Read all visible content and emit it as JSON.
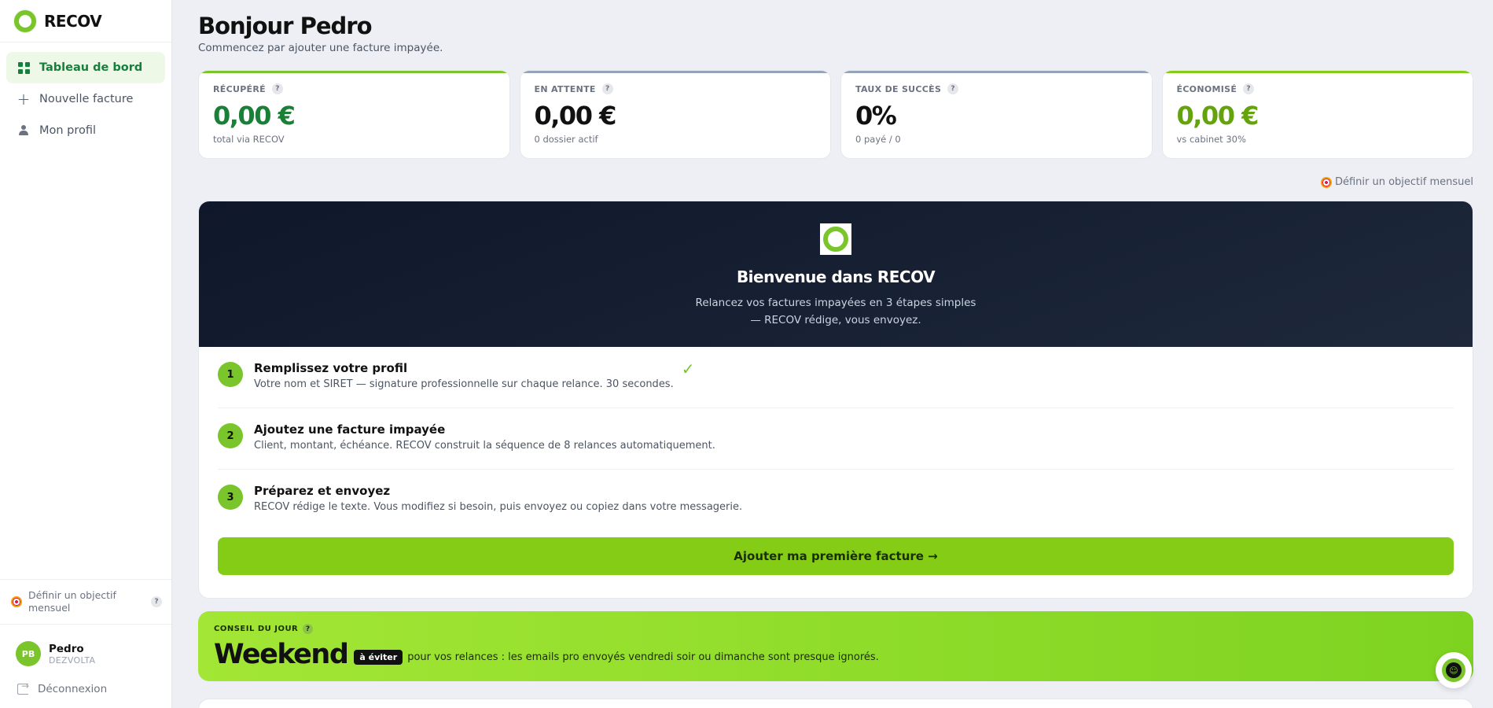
{
  "brand": {
    "name": "RECOV"
  },
  "sidebar": {
    "items": [
      {
        "label": "Tableau de bord",
        "icon": "dashboard-grid-icon",
        "active": true
      },
      {
        "label": "Nouvelle facture",
        "icon": "plus-icon",
        "active": false
      },
      {
        "label": "Mon profil",
        "icon": "user-icon",
        "active": false
      }
    ],
    "goal": {
      "label": "Définir un objectif mensuel",
      "help": "?"
    },
    "user": {
      "initials": "PB",
      "name": "Pedro",
      "company": "DEZVOLTA"
    },
    "logout": "Déconnexion"
  },
  "header": {
    "greeting": "Bonjour Pedro",
    "subtitle": "Commencez par ajouter une facture impayée."
  },
  "stats": [
    {
      "label": "RÉCUPÉRÉ",
      "help": "?",
      "value": "0,00 €",
      "sub": "total via RECOV",
      "color": "#1a7f37",
      "bar": "#7ac52b"
    },
    {
      "label": "EN ATTENTE",
      "help": "?",
      "value": "0,00 €",
      "sub": "0 dossier actif",
      "color": "#111111",
      "bar": "#94a3b8"
    },
    {
      "label": "TAUX DE SUCCÈS",
      "help": "?",
      "value": "0%",
      "sub": "0 payé / 0",
      "color": "#111111",
      "bar": "#94a3b8"
    },
    {
      "label": "ÉCONOMISÉ",
      "help": "?",
      "value": "0,00 €",
      "sub": "vs cabinet 30%",
      "color": "#65a30d",
      "bar": "#84cc16"
    }
  ],
  "goal_link": "Définir un objectif mensuel",
  "welcome": {
    "title": "Bienvenue dans RECOV",
    "subtitle_line1": "Relancez vos factures impayées en 3 étapes simples",
    "subtitle_line2": "— RECOV rédige, vous envoyez.",
    "steps": [
      {
        "num": "1",
        "title": "Remplissez votre profil",
        "desc": "Votre nom et SIRET — signature professionnelle sur chaque relance. 30 secondes.",
        "done": "✓"
      },
      {
        "num": "2",
        "title": "Ajoutez une facture impayée",
        "desc": "Client, montant, échéance. RECOV construit la séquence de 8 relances automatiquement."
      },
      {
        "num": "3",
        "title": "Préparez et envoyez",
        "desc": "RECOV rédige le texte. Vous modifiez si besoin, puis envoyez ou copiez dans votre messagerie."
      }
    ],
    "cta": "Ajouter ma première facture →"
  },
  "tip": {
    "label": "CONSEIL DU JOUR",
    "help": "?",
    "headline": "Weekend",
    "badge": "à éviter",
    "text": "pour vos relances : les emails pro envoyés vendredi soir ou dimanche sont presque ignorés."
  },
  "chat": {
    "icon": "chat-assistant-icon",
    "face": "☺"
  }
}
